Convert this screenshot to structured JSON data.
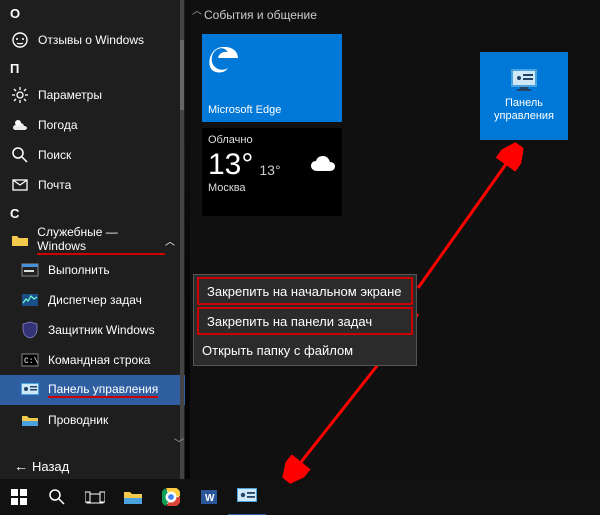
{
  "sections": {
    "o": "О",
    "p": "П",
    "c": "С"
  },
  "items": {
    "reviews": "Отзывы о Windows",
    "settings": "Параметры",
    "weather": "Погода",
    "search": "Поиск",
    "mail": "Почта",
    "sysfolder": "Служебные — Windows",
    "run": "Выполнить",
    "taskmgr": "Диспетчер задач",
    "defender": "Защитник Windows",
    "cmd": "Командная строка",
    "cpanel": "Панель управления",
    "explorer": "Проводник",
    "back": "Назад"
  },
  "tiles": {
    "group": "События и общение",
    "edge": "Microsoft Edge",
    "cp_line1": "Панель",
    "cp_line2": "управления",
    "w_cond": "Облачно",
    "w_t": "13°",
    "w_t2": "13°",
    "w_loc": "Москва"
  },
  "ctx": {
    "pin_start": "Закрепить на начальном экране",
    "pin_task": "Закрепить на панели задач",
    "open_loc": "Открыть папку с файлом"
  }
}
